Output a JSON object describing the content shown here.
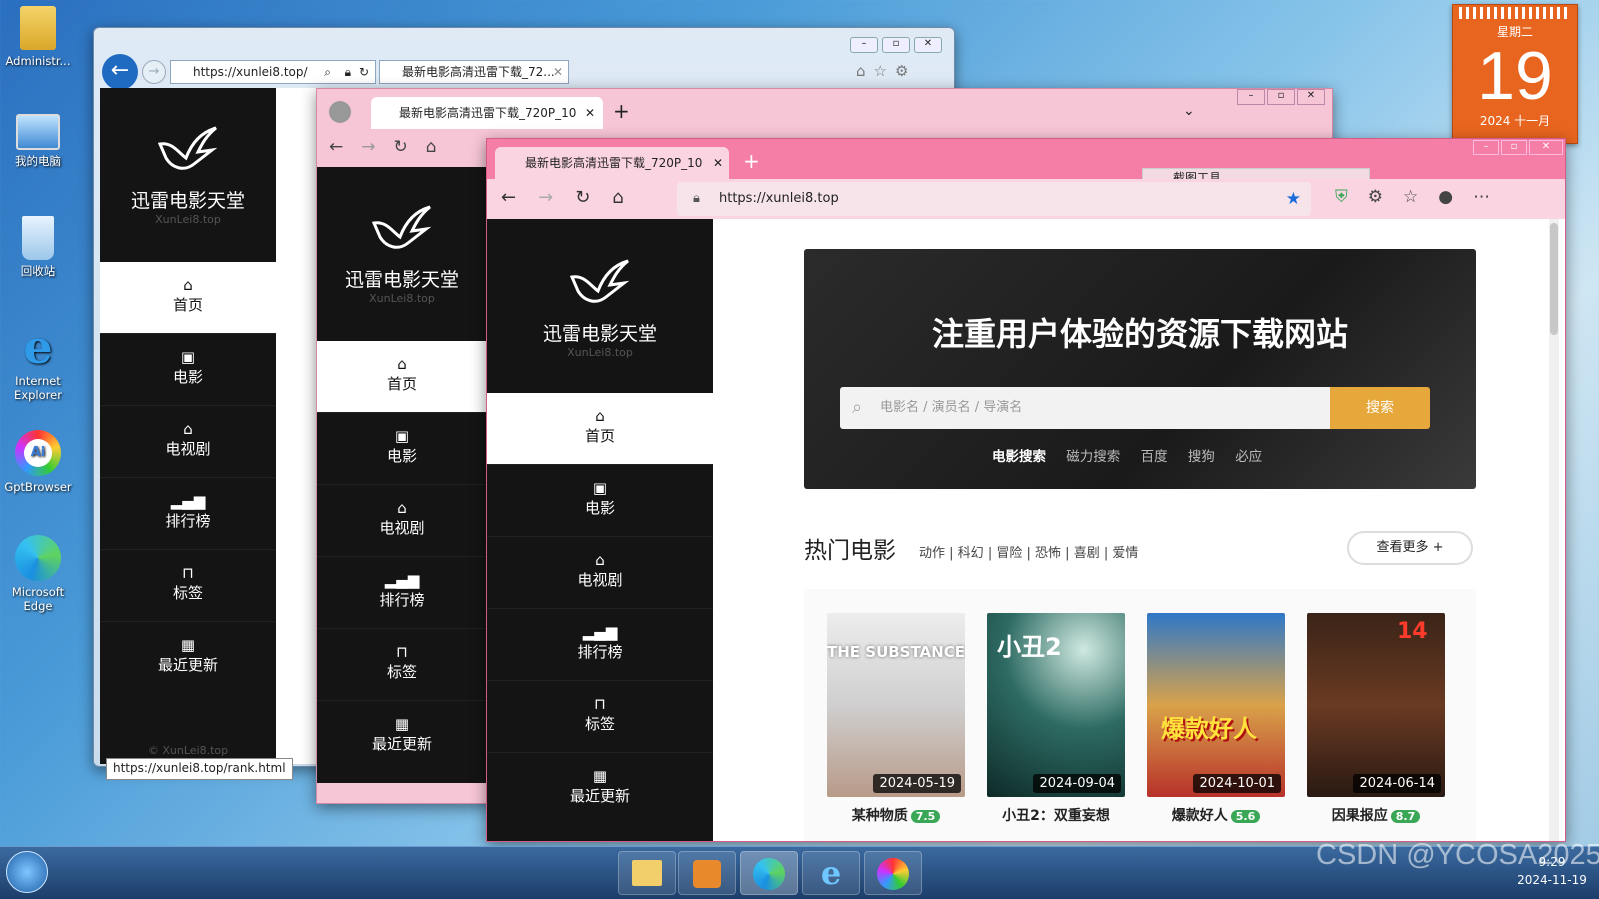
{
  "desktop": {
    "icons": [
      {
        "label": "Administr..."
      },
      {
        "label": "我的电脑"
      },
      {
        "label": "回收站"
      },
      {
        "label": "Internet Explorer"
      },
      {
        "label": "GptBrowser"
      },
      {
        "label": "Microsoft Edge"
      }
    ],
    "calendar": {
      "weekday": "星期二",
      "day": "19",
      "year_month": "2024 十一月"
    }
  },
  "ie_window": {
    "address": "https://xunlei8.top/",
    "tab_title": "最新电影高清迅雷下载_72...",
    "status_url": "https://xunlei8.top/rank.html",
    "footer": "© XunLei8.top"
  },
  "gpt_window": {
    "tab_title": "最新电影高清迅雷下载_720P_10"
  },
  "edge_window": {
    "tab_title": "最新电影高清迅雷下载_720P_10",
    "address": "https://xunlei8.top",
    "snip_tool_label": "截图工具"
  },
  "site": {
    "name": "迅雷电影天堂",
    "domain": "XunLei8.top",
    "nav": [
      {
        "label": "首页",
        "icon": "home-icon"
      },
      {
        "label": "电影",
        "icon": "film-icon"
      },
      {
        "label": "电视剧",
        "icon": "tv-icon"
      },
      {
        "label": "排行榜",
        "icon": "chart-icon"
      },
      {
        "label": "标签",
        "icon": "bookmark-icon"
      },
      {
        "label": "最近更新",
        "icon": "calendar-icon"
      }
    ],
    "hero": {
      "title": "注重用户体验的资源下载网站",
      "search_placeholder": "电影名 / 演员名 / 导演名",
      "search_button": "搜索",
      "search_types": [
        "电影搜索",
        "磁力搜索",
        "百度",
        "搜狗",
        "必应"
      ]
    },
    "hot": {
      "heading": "热门电影",
      "genres": [
        "动作",
        "科幻",
        "冒险",
        "恐怖",
        "喜剧",
        "爱情"
      ],
      "more": "查看更多 +",
      "movies": [
        {
          "title": "某种物质",
          "score": "7.5",
          "date": "2024-05-19",
          "poster_text": "THE SUBSTANCE"
        },
        {
          "title": "小丑2：双重妄想",
          "score": "",
          "date": "2024-09-04",
          "poster_text": "小丑2"
        },
        {
          "title": "爆款好人",
          "score": "5.6",
          "date": "2024-10-01",
          "poster_text": "爆款好人"
        },
        {
          "title": "因果报应",
          "score": "8.7",
          "date": "2024-06-14",
          "poster_text": "14"
        }
      ]
    }
  },
  "taskbar": {
    "watermark": "CSDN @YCOSA2025",
    "clock_time": "9:29",
    "clock_date": "2024-11-19"
  }
}
